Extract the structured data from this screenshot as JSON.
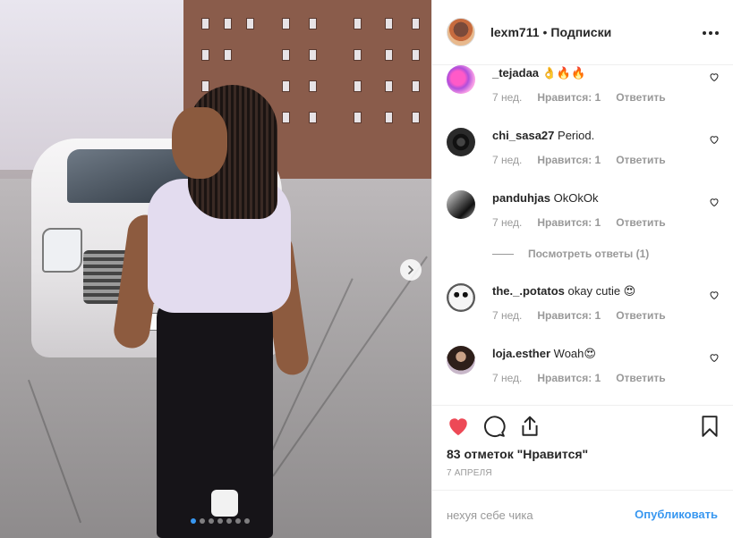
{
  "post": {
    "author": "lexm711",
    "separator": "•",
    "follow_label": "Подписки",
    "carousel": {
      "slides": 7,
      "active_index": 0
    }
  },
  "comments": [
    {
      "user": "_tejadaa",
      "text": "👌🔥🔥",
      "age": "7 нед.",
      "likes": "Нравится: 1",
      "reply": "Ответить"
    },
    {
      "user": "chi_sasa27",
      "text": "Period.",
      "age": "7 нед.",
      "likes": "Нравится: 1",
      "reply": "Ответить"
    },
    {
      "user": "panduhjas",
      "text": "OkOkOk",
      "age": "7 нед.",
      "likes": "Нравится: 1",
      "reply": "Ответить"
    },
    {
      "user": "the._.potatos",
      "text": "okay cutie 😍",
      "age": "7 нед.",
      "likes": "Нравится: 1",
      "reply": "Ответить"
    },
    {
      "user": "loja.esther",
      "text": "Woah😍",
      "age": "7 нед.",
      "likes": "Нравится: 1",
      "reply": "Ответить"
    }
  ],
  "view_replies": "Посмотреть ответы (1)",
  "likes_count": "83 отметок \"Нравится\"",
  "date": "7 АПРЕЛЯ",
  "comment_box": {
    "value": "нехуя себе чика",
    "publish_label": "Опубликовать"
  },
  "colors": {
    "like_red": "#ed4956",
    "link_blue": "#3897f0",
    "meta_grey": "#999999"
  }
}
